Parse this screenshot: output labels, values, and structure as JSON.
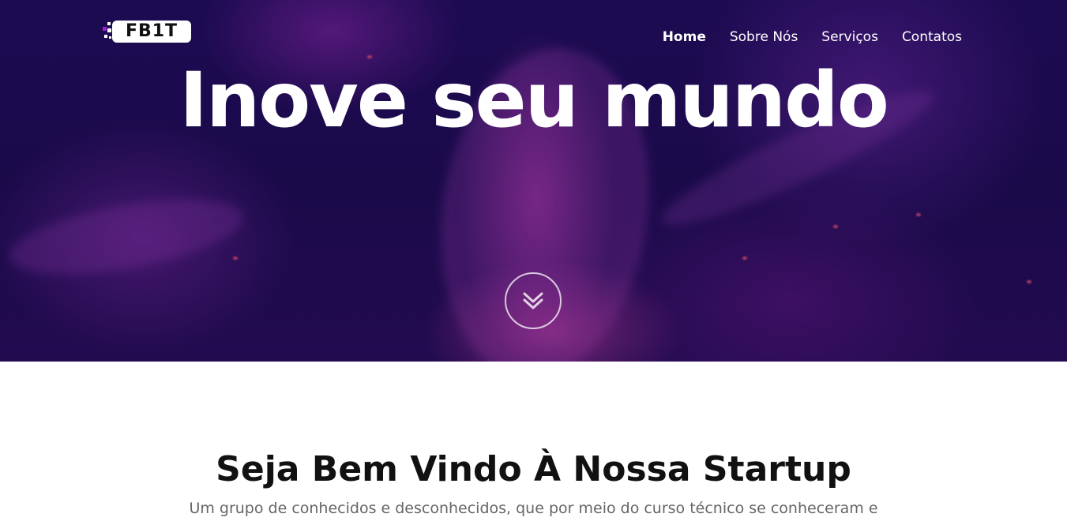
{
  "brand": {
    "logo_text": "FB1T"
  },
  "nav": {
    "items": [
      {
        "label": "Home",
        "active": true
      },
      {
        "label": "Sobre Nós",
        "active": false
      },
      {
        "label": "Serviços",
        "active": false
      },
      {
        "label": "Contatos",
        "active": false
      }
    ]
  },
  "hero": {
    "title": "Inove seu mundo",
    "scroll_icon": "double-chevron-down-icon"
  },
  "welcome": {
    "title": "Seja Bem Vindo À Nossa Startup",
    "text": "Um grupo de conhecidos e desconhecidos, que por meio do curso técnico se conheceram e"
  }
}
